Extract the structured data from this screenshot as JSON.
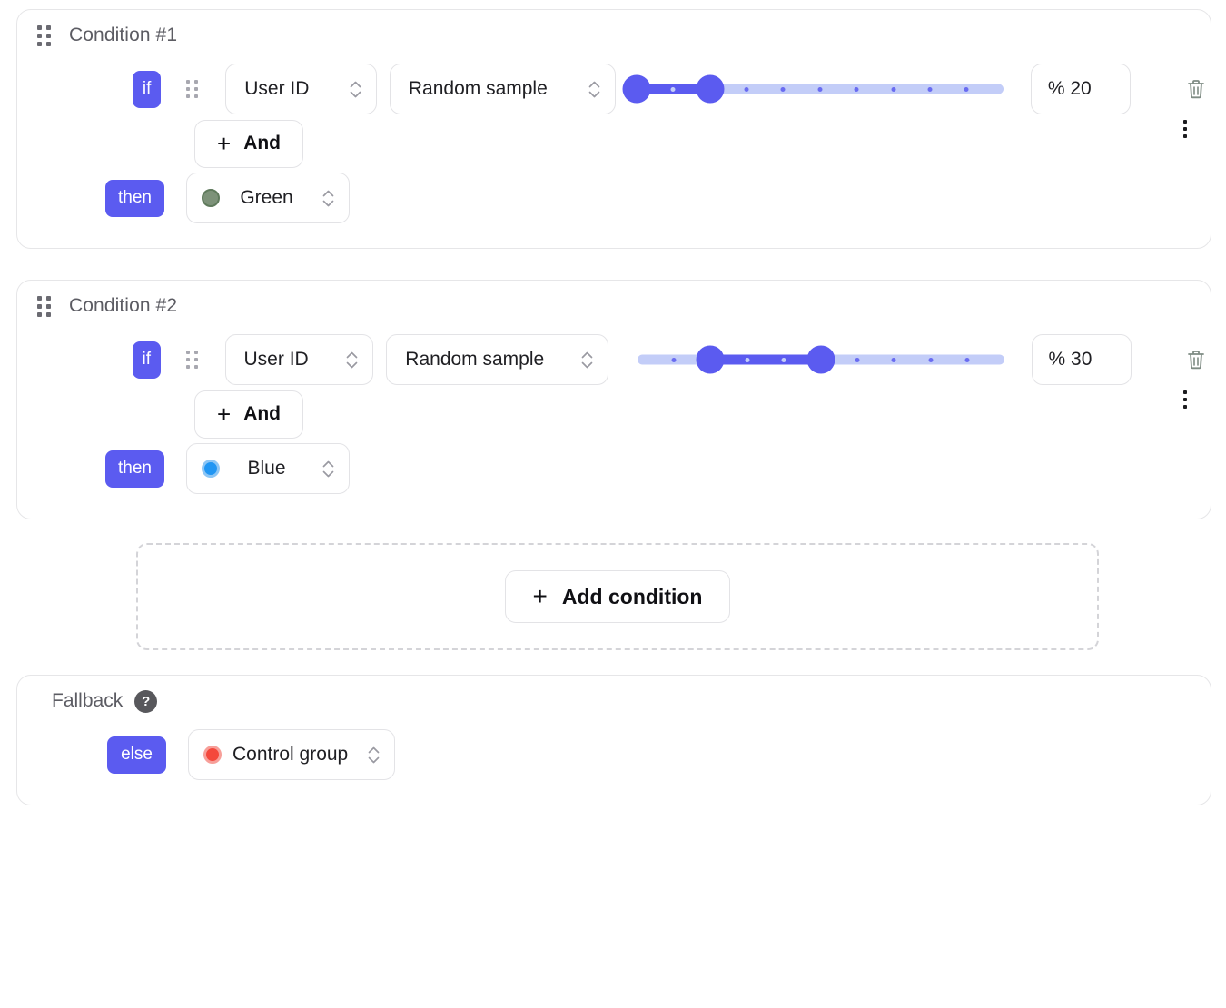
{
  "conditions": [
    {
      "title": "Condition #1",
      "if_label": "if",
      "then_label": "then",
      "and_label": "And",
      "attribute": "User ID",
      "operator": "Random sample",
      "percent_value": "% 20",
      "percent_placeholder": "% 0",
      "slider": {
        "start": 0,
        "end": 20,
        "min": 0,
        "max": 100,
        "ticks": [
          10,
          20,
          30,
          40,
          50,
          60,
          70,
          80,
          90
        ]
      },
      "result": {
        "label": "Green",
        "color": "#7d9279"
      }
    },
    {
      "title": "Condition #2",
      "if_label": "if",
      "then_label": "then",
      "and_label": "And",
      "attribute": "User ID",
      "operator": "Random sample",
      "percent_value": "% 30",
      "percent_placeholder": "% 0",
      "slider": {
        "start": 20,
        "end": 50,
        "min": 0,
        "max": 100,
        "ticks": [
          10,
          20,
          30,
          40,
          50,
          60,
          70,
          80,
          90
        ]
      },
      "result": {
        "label": "Blue",
        "color": "#2196f3"
      }
    }
  ],
  "add_condition": {
    "label": "Add condition",
    "plus": "+"
  },
  "fallback": {
    "title": "Fallback",
    "help_glyph": "?",
    "else_label": "else",
    "result": {
      "label": "Control group",
      "color": "#f4483c"
    }
  },
  "icons": {
    "plus": "+",
    "drag": "drag-handle",
    "kebab": "more-vertical",
    "trash": "trash",
    "chevron_up": "chevron-up",
    "chevron_down": "chevron-down"
  },
  "theme": {
    "accent": "#5b5bf0",
    "track": "#c3cdf8",
    "card_border": "#e6e6e8",
    "text": "#1f1f23",
    "muted": "#5c5c63"
  }
}
